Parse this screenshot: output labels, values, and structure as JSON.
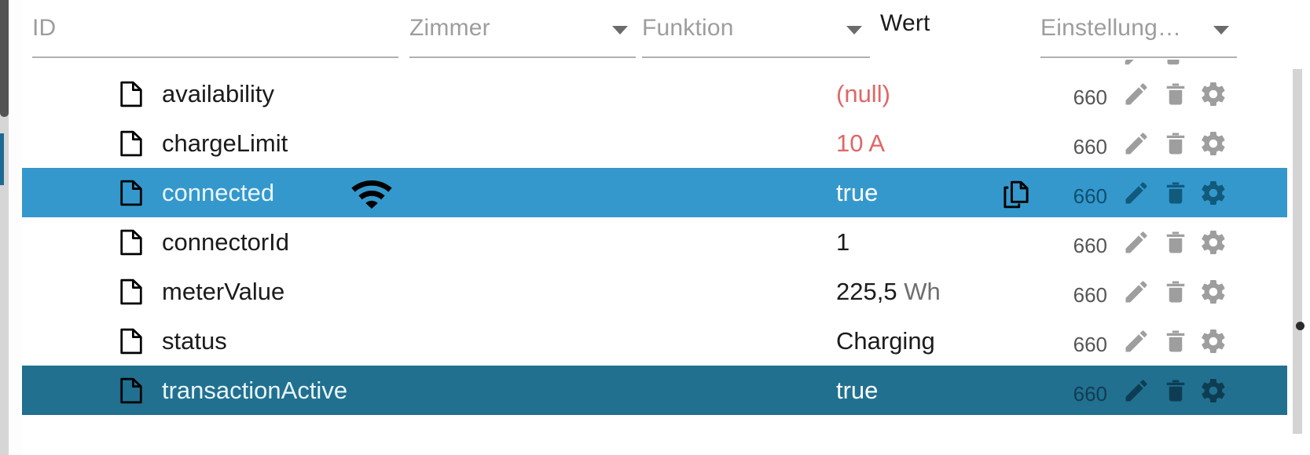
{
  "filters": {
    "id": {
      "placeholder": "ID",
      "value": "",
      "icon": "text-input"
    },
    "zimmer": {
      "label": "Zimmer",
      "icon": "chevron-down-icon"
    },
    "funktion": {
      "label": "Funktion",
      "icon": "chevron-down-icon"
    },
    "wert": {
      "label": "Wert"
    },
    "einstellung": {
      "label": "Einstellung…",
      "icon": "chevron-down-icon"
    }
  },
  "icons": {
    "file": "file-icon",
    "wifi": "wifi-icon",
    "copy": "copy-icon",
    "edit": "pencil-icon",
    "delete": "trash-icon",
    "config": "gear-icon",
    "caret": "chevron-down-icon"
  },
  "colors": {
    "selected_row": "#3498cc",
    "selected_row_alt": "#21708f",
    "alert_text": "#e06666",
    "muted_text": "#9d9d9d",
    "icon_grey": "#9e9e9e"
  },
  "table": {
    "columns": [
      "ID",
      "Zimmer",
      "Funktion",
      "Wert",
      "Einstellung…"
    ],
    "rows": [
      {
        "id": "availability",
        "value": "(null)",
        "unit": "",
        "alert": true,
        "setting": "660",
        "selected": "none",
        "wifi": false,
        "copy": false
      },
      {
        "id": "chargeLimit",
        "value": "10",
        "unit": "A",
        "alert": true,
        "setting": "660",
        "selected": "none",
        "wifi": false,
        "copy": false
      },
      {
        "id": "connected",
        "value": "true",
        "unit": "",
        "alert": false,
        "setting": "660",
        "selected": "sel",
        "wifi": true,
        "copy": true
      },
      {
        "id": "connectorId",
        "value": "1",
        "unit": "",
        "alert": false,
        "setting": "660",
        "selected": "none",
        "wifi": false,
        "copy": false
      },
      {
        "id": "meterValue",
        "value": "225,5",
        "unit": "Wh",
        "alert": false,
        "setting": "660",
        "selected": "none",
        "wifi": false,
        "copy": false
      },
      {
        "id": "status",
        "value": "Charging",
        "unit": "",
        "alert": false,
        "setting": "660",
        "selected": "none",
        "wifi": false,
        "copy": false
      },
      {
        "id": "transactionActive",
        "value": "true",
        "unit": "",
        "alert": false,
        "setting": "660",
        "selected": "sel2",
        "wifi": false,
        "copy": false
      }
    ]
  }
}
